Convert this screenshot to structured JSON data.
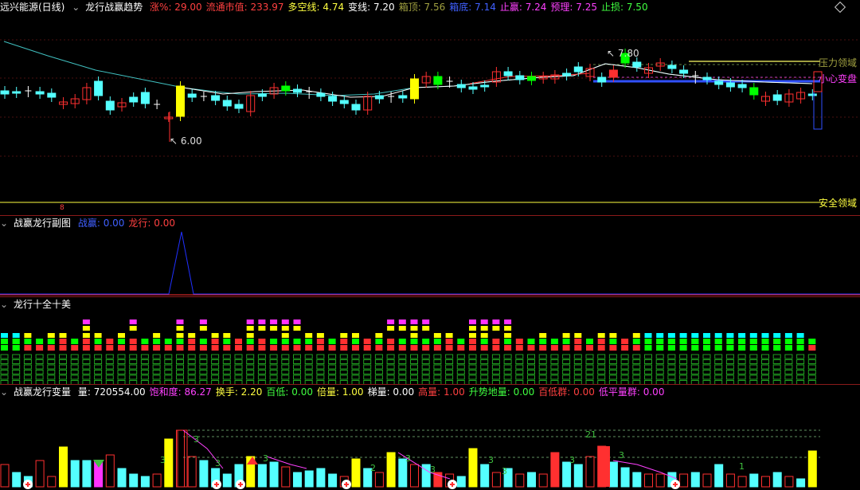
{
  "main": {
    "stock_name": "远兴能源(日线)",
    "indicator_name": "龙行战赢趋势",
    "fields": [
      {
        "label": "涨%:",
        "value": "29.00",
        "color": "#ff4040"
      },
      {
        "label": "流通市值:",
        "value": "233.97",
        "color": "#ff4040"
      },
      {
        "label": "多空线:",
        "value": "4.74",
        "color": "#ffff40"
      },
      {
        "label": "变线:",
        "value": "7.20",
        "color": "#ffffff"
      },
      {
        "label": "箱顶:",
        "value": "7.56",
        "color": "#a0a040"
      },
      {
        "label": "箱底:",
        "value": "7.14",
        "color": "#4060ff"
      },
      {
        "label": "止赢:",
        "value": "7.24",
        "color": "#ff40ff"
      },
      {
        "label": "预理:",
        "value": "7.25",
        "color": "#ff40ff"
      },
      {
        "label": "止损:",
        "value": "7.50",
        "color": "#40ff40"
      }
    ],
    "hi_label": "7.80",
    "lo_label": "6.00",
    "right_labels": {
      "pressure": "压力领域",
      "caution": "小心变盘",
      "safe": "安全领域"
    },
    "bottom_marker": "8"
  },
  "sub1": {
    "title": "战赢龙行副图",
    "fields": [
      {
        "label": "战赢:",
        "value": "0.00",
        "color": "#4060ff"
      },
      {
        "label": "龙行:",
        "value": "0.00",
        "color": "#ff4040"
      }
    ]
  },
  "sub2": {
    "title": "龙行十全十美"
  },
  "sub3": {
    "title": "战赢龙行变量",
    "fields": [
      {
        "label": "量:",
        "value": "720554.00",
        "color": "#ffffff"
      },
      {
        "label": "饱和度:",
        "value": "86.27",
        "color": "#ff40ff"
      },
      {
        "label": "换手:",
        "value": "2.20",
        "color": "#ffff40"
      },
      {
        "label": "百低:",
        "value": "0.00",
        "color": "#40ff40"
      },
      {
        "label": "倍量:",
        "value": "1.00",
        "color": "#ffff40"
      },
      {
        "label": "梯量:",
        "value": "0.00",
        "color": "#ffffff"
      },
      {
        "label": "高量:",
        "value": "1.00",
        "color": "#ff4040"
      },
      {
        "label": "升势地量:",
        "value": "0.00",
        "color": "#40ff40"
      },
      {
        "label": "百低群:",
        "value": "0.00",
        "color": "#ff4040"
      },
      {
        "label": "低平量群:",
        "value": "0.00",
        "color": "#ff40ff"
      }
    ],
    "count_labels": [
      "3",
      "3",
      "3",
      "3",
      "2",
      "3",
      "3",
      "3",
      "3",
      "21",
      "3",
      "3",
      "1"
    ]
  },
  "colors": {
    "up": "#ff3030",
    "down": "#54ffff",
    "yellow": "#ffff00",
    "green": "#00ff00",
    "magenta": "#ff33ff",
    "separator": "#8b1a1a"
  }
}
